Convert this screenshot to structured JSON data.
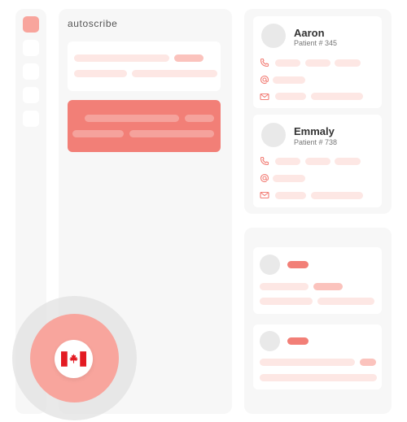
{
  "app": {
    "logo_text": "autoscribe",
    "brand_color": "#f27f77"
  },
  "sidebar": {
    "items": [
      {
        "icon": "active-nav-icon",
        "active": true
      },
      {
        "icon": "nav-icon"
      },
      {
        "icon": "nav-icon"
      },
      {
        "icon": "nav-icon"
      },
      {
        "icon": "nav-icon"
      }
    ]
  },
  "patients": [
    {
      "name": "Aaron",
      "patient_no": "Patient # 345"
    },
    {
      "name": "Emmaly",
      "patient_no": "Patient # 738"
    }
  ],
  "contact_icons": [
    "phone-icon",
    "at-sign-icon",
    "mail-icon"
  ],
  "locale_button": {
    "icon": "canada-flag-icon"
  },
  "colors": {
    "accent": "#f27f77",
    "accent_light": "#fde7e4",
    "panel": "#f7f7f7"
  }
}
